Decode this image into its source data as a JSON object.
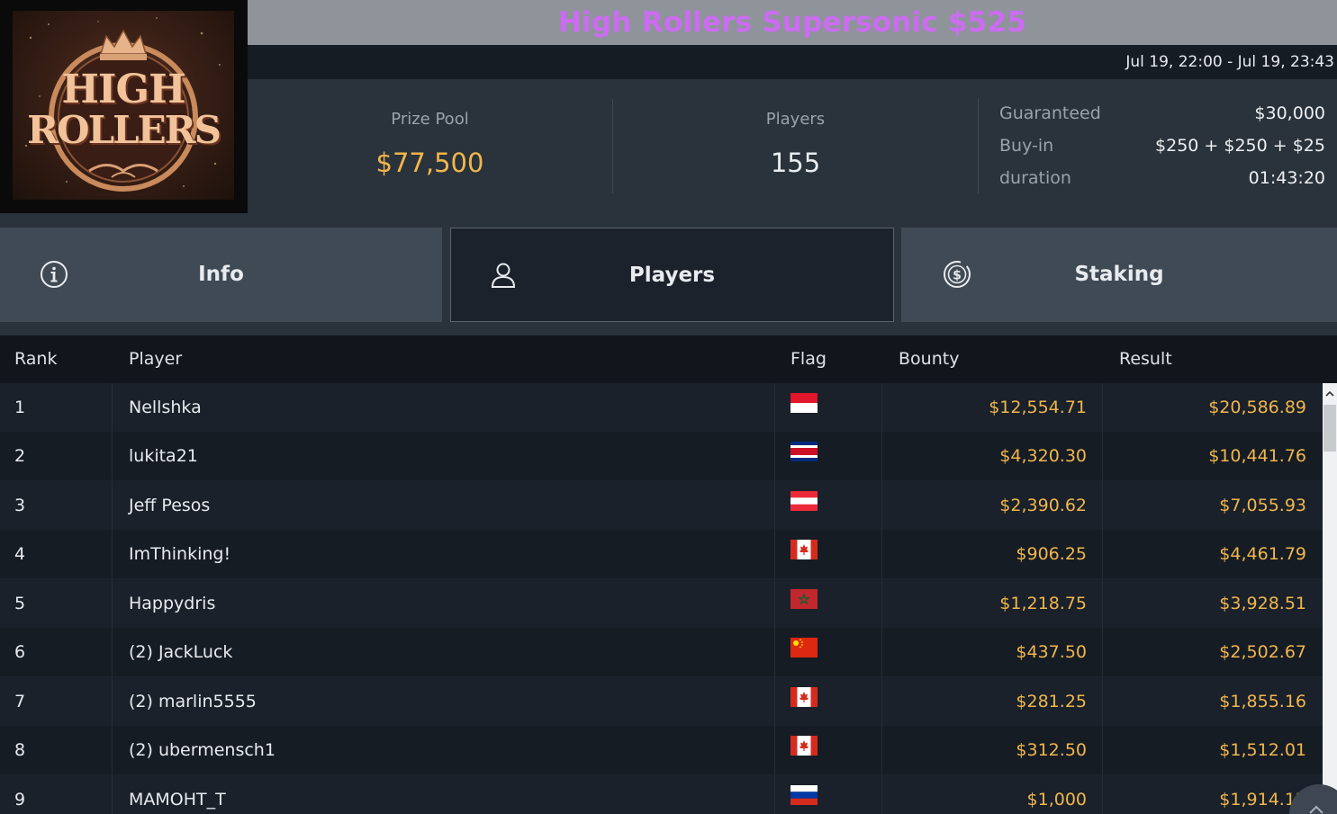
{
  "logo": {
    "line1": "HIGH",
    "line2": "ROLLERS"
  },
  "title": "High Rollers Supersonic $525",
  "date_range": "Jul 19, 22:00 - Jul 19, 23:43",
  "stats": {
    "prize_pool_label": "Prize Pool",
    "prize_pool_value": "$77,500",
    "players_label": "Players",
    "players_value": "155",
    "guaranteed_label": "Guaranteed",
    "guaranteed_value": "$30,000",
    "buyin_label": "Buy-in",
    "buyin_value": "$250 + $250 + $25",
    "duration_label": "duration",
    "duration_value": "01:43:20"
  },
  "tabs": [
    {
      "label": "Info",
      "icon": "info-icon",
      "active": false
    },
    {
      "label": "Players",
      "icon": "user-icon",
      "active": true
    },
    {
      "label": "Staking",
      "icon": "dollar-coin-icon",
      "active": false
    }
  ],
  "table": {
    "headers": {
      "rank": "Rank",
      "player": "Player",
      "flag": "Flag",
      "bounty": "Bounty",
      "result": "Result"
    },
    "rows": [
      {
        "rank": "1",
        "player": "Nellshka",
        "flag": "indonesia",
        "bounty": "$12,554.71",
        "result": "$20,586.89"
      },
      {
        "rank": "2",
        "player": "lukita21",
        "flag": "costa-rica",
        "bounty": "$4,320.30",
        "result": "$10,441.76"
      },
      {
        "rank": "3",
        "player": "Jeff Pesos",
        "flag": "austria",
        "bounty": "$2,390.62",
        "result": "$7,055.93"
      },
      {
        "rank": "4",
        "player": "ImThinking!",
        "flag": "canada",
        "bounty": "$906.25",
        "result": "$4,461.79"
      },
      {
        "rank": "5",
        "player": "Happydris",
        "flag": "morocco",
        "bounty": "$1,218.75",
        "result": "$3,928.51"
      },
      {
        "rank": "6",
        "player": "(2) JackLuck",
        "flag": "china",
        "bounty": "$437.50",
        "result": "$2,502.67"
      },
      {
        "rank": "7",
        "player": "(2) marlin5555",
        "flag": "canada",
        "bounty": "$281.25",
        "result": "$1,855.16"
      },
      {
        "rank": "8",
        "player": "(2) ubermensch1",
        "flag": "canada",
        "bounty": "$312.50",
        "result": "$1,512.01"
      },
      {
        "rank": "9",
        "player": "MAMOHT_T",
        "flag": "russia",
        "bounty": "$1,000",
        "result": "$1,914.17"
      }
    ]
  },
  "colors": {
    "gold": "#f0b64d",
    "title_purple": "#cb6cf1",
    "title_bar": "#8f949b"
  }
}
